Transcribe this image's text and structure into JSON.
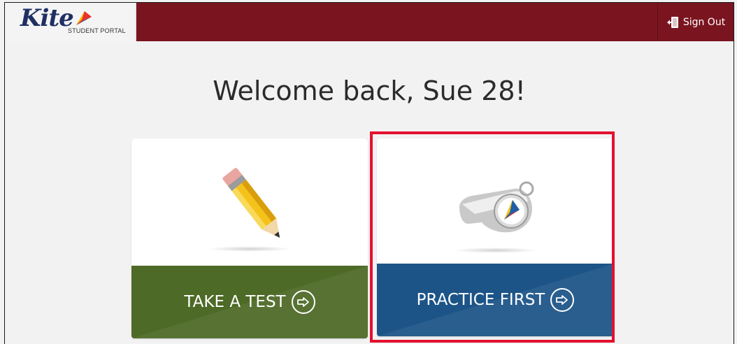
{
  "header": {
    "logo_text": "Kite",
    "logo_subtitle": "STUDENT PORTAL",
    "signout_label": "Sign Out"
  },
  "welcome": {
    "message": "Welcome back, Sue 28!"
  },
  "cards": [
    {
      "label": "TAKE A TEST",
      "icon": "pencil-icon",
      "color": "#4d6a26"
    },
    {
      "label": "PRACTICE FIRST",
      "icon": "whistle-icon",
      "color": "#1c5488"
    }
  ],
  "colors": {
    "header_bg": "#7a1520",
    "highlight": "#e4102f",
    "page_bg": "#f2f2f2"
  }
}
